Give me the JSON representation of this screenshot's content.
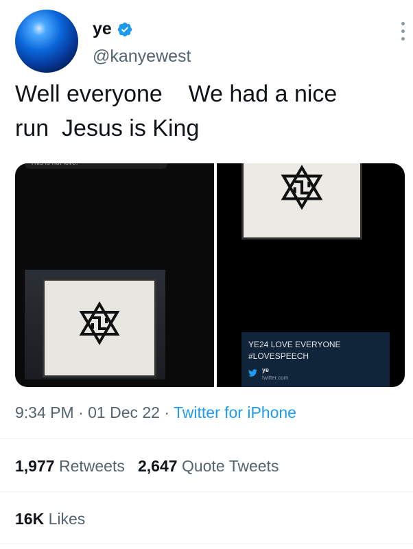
{
  "user": {
    "display_name": "ye",
    "handle": "@kanyewest",
    "verified": true
  },
  "tweet": {
    "text": "Well everyone    We had a nice\nrun  Jesus is King"
  },
  "media": {
    "left_panel": {
      "top_caption": "This is not love."
    },
    "right_panel": {
      "card": {
        "title": "YE24 LOVE EVERYONE",
        "tag": "#LOVESPEECH",
        "user": "ye",
        "domain": "twitter.com"
      }
    }
  },
  "meta": {
    "time": "9:34 PM",
    "sep1": " · ",
    "date": "01 Dec 22",
    "sep2": " · ",
    "source": "Twitter for iPhone"
  },
  "stats": {
    "retweets_count": "1,977",
    "retweets_label": "Retweets",
    "quotes_count": "2,647",
    "quotes_label": "Quote Tweets",
    "likes_count": "16K",
    "likes_label": "Likes"
  },
  "colors": {
    "accent": "#1d9bf0",
    "secondary_text": "#536471",
    "primary_text": "#0f1419"
  },
  "icons": [
    "verified-badge-icon",
    "more-options-icon",
    "twitter-bird-icon"
  ]
}
